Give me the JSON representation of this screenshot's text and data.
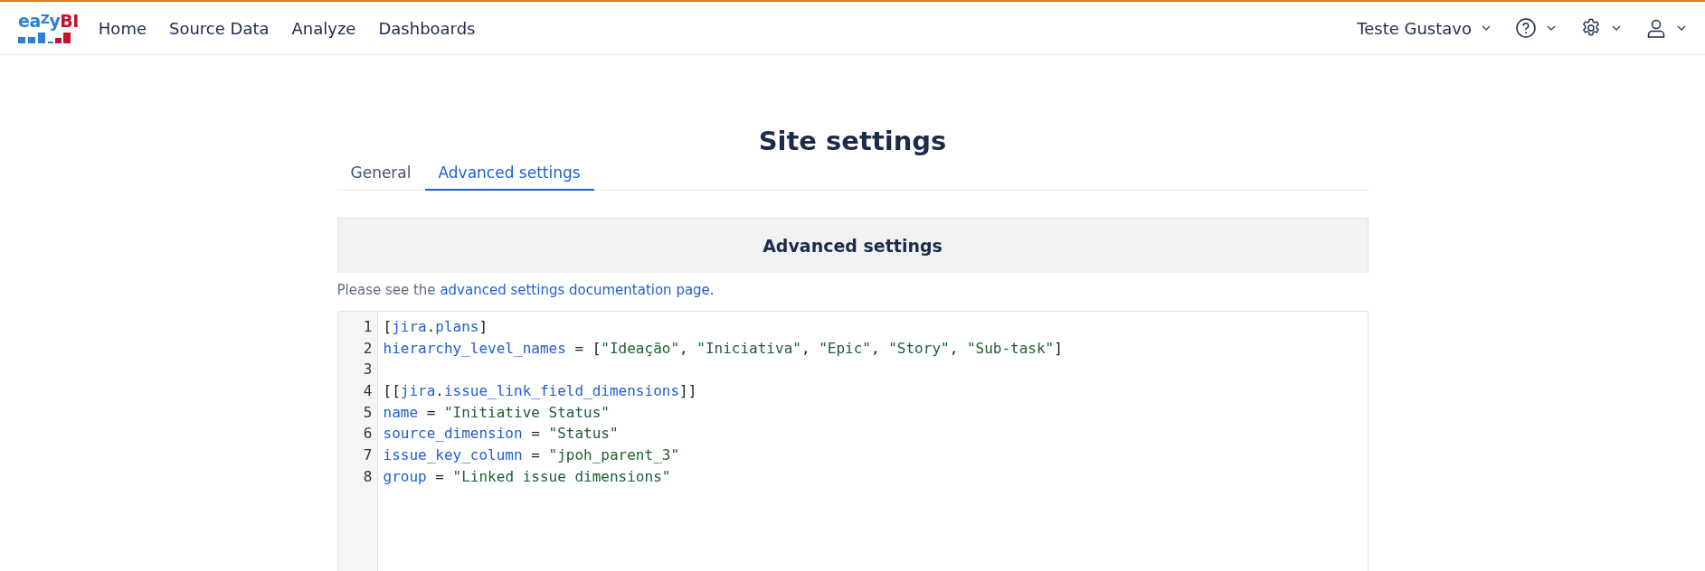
{
  "logo": {
    "parts": [
      {
        "text": "ea",
        "kind": "blue"
      },
      {
        "text": "Z",
        "kind": "raised"
      },
      {
        "text": "y",
        "kind": "blue"
      },
      {
        "text": "BI",
        "kind": "red"
      }
    ]
  },
  "nav": [
    {
      "label": "Home"
    },
    {
      "label": "Source Data"
    },
    {
      "label": "Analyze"
    },
    {
      "label": "Dashboards"
    }
  ],
  "user_menu": {
    "label": "Teste Gustavo"
  },
  "page_title": "Site settings",
  "tabs": [
    {
      "label": "General",
      "selected": false
    },
    {
      "label": "Advanced settings",
      "selected": true
    }
  ],
  "panel": {
    "title": "Advanced settings"
  },
  "help": {
    "text": "Please see the ",
    "link": "advanced settings documentation page."
  },
  "editor": {
    "lines": [
      {
        "number": "1",
        "tokens": [
          {
            "kind": "punct",
            "text": "["
          },
          {
            "kind": "key",
            "text": "jira"
          },
          {
            "kind": "punct",
            "text": "."
          },
          {
            "kind": "key",
            "text": "plans"
          },
          {
            "kind": "punct",
            "text": "]"
          }
        ]
      },
      {
        "number": "2",
        "tokens": [
          {
            "kind": "key",
            "text": "hierarchy_level_names"
          },
          {
            "kind": "punct",
            "text": " = ["
          },
          {
            "kind": "string",
            "text": "\"Ideação\""
          },
          {
            "kind": "punct",
            "text": ", "
          },
          {
            "kind": "string",
            "text": "\"Iniciativa\""
          },
          {
            "kind": "punct",
            "text": ", "
          },
          {
            "kind": "string",
            "text": "\"Epic\""
          },
          {
            "kind": "punct",
            "text": ", "
          },
          {
            "kind": "string",
            "text": "\"Story\""
          },
          {
            "kind": "punct",
            "text": ", "
          },
          {
            "kind": "string",
            "text": "\"Sub-task\""
          },
          {
            "kind": "punct",
            "text": "]"
          }
        ]
      },
      {
        "number": "3"
      },
      {
        "number": "4",
        "tokens": [
          {
            "kind": "punct",
            "text": "[["
          },
          {
            "kind": "key",
            "text": "jira"
          },
          {
            "kind": "punct",
            "text": "."
          },
          {
            "kind": "key",
            "text": "issue_link_field_dimensions"
          },
          {
            "kind": "punct",
            "text": "]]"
          }
        ]
      },
      {
        "number": "5",
        "tokens": [
          {
            "kind": "key",
            "text": "name"
          },
          {
            "kind": "punct",
            "text": " = "
          },
          {
            "kind": "string",
            "text": "\"Initiative Status\""
          }
        ]
      },
      {
        "number": "6",
        "tokens": [
          {
            "kind": "key",
            "text": "source_dimension"
          },
          {
            "kind": "punct",
            "text": " = "
          },
          {
            "kind": "string",
            "text": "\"Status\""
          }
        ]
      },
      {
        "number": "7",
        "tokens": [
          {
            "kind": "key",
            "text": "issue_key_column"
          },
          {
            "kind": "punct",
            "text": " = "
          },
          {
            "kind": "string",
            "text": "\"jpoh_parent_3\""
          }
        ]
      },
      {
        "number": "8",
        "tokens": [
          {
            "kind": "key",
            "text": "group"
          },
          {
            "kind": "punct",
            "text": " = "
          },
          {
            "kind": "string",
            "text": "\"Linked issue dimensions\""
          }
        ]
      }
    ]
  }
}
